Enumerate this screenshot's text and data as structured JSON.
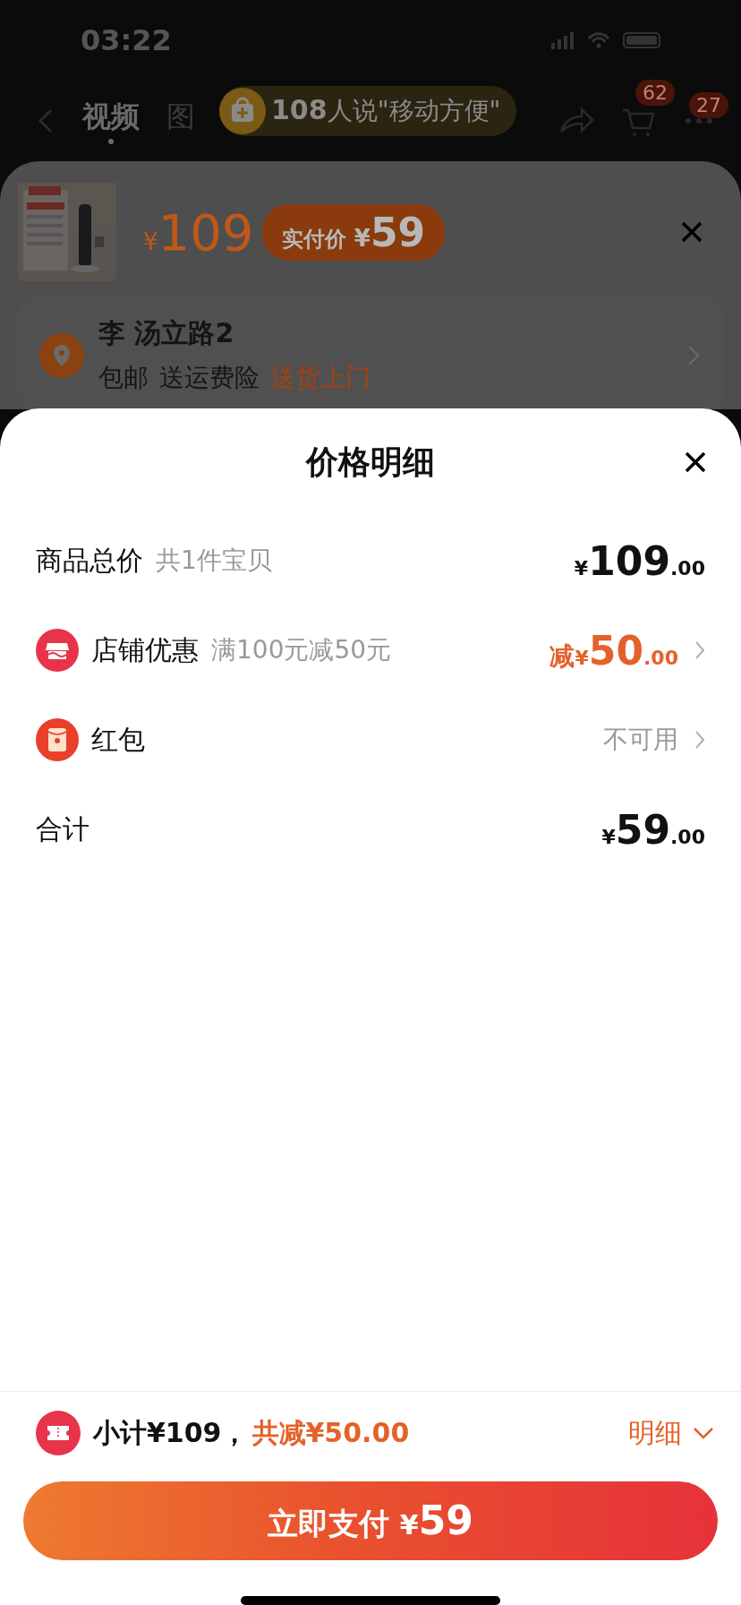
{
  "status_bar": {
    "time": "03:22"
  },
  "nav": {
    "tabs": [
      {
        "label": "视频",
        "selected": true
      },
      {
        "label": "图",
        "selected": false
      }
    ],
    "banner": {
      "count": "108",
      "text": "人说\"移动方便\""
    },
    "cart_badge": "62",
    "more_badge": "27"
  },
  "order_sheet": {
    "price": {
      "currency": "¥",
      "amount": "109"
    },
    "pay_price": {
      "label": "实付价",
      "currency": "¥",
      "amount": "59"
    },
    "address": {
      "name": "李 汤立路2",
      "tags": [
        {
          "text": "包邮",
          "highlight": false
        },
        {
          "text": "送运费险",
          "highlight": false
        },
        {
          "text": "送货上门",
          "highlight": true
        }
      ]
    }
  },
  "price_detail": {
    "title": "价格明细",
    "rows": [
      {
        "kind": "plain",
        "label": "商品总价",
        "note": "共1件宝贝",
        "price": {
          "currency": "¥",
          "integer": "109",
          "decimals": ".00"
        }
      },
      {
        "kind": "shop_discount",
        "label": "店铺优惠",
        "note": "满100元减50元",
        "price": {
          "prefix": "减",
          "currency": "¥",
          "integer": "50",
          "decimals": ".00"
        }
      },
      {
        "kind": "red_packet",
        "label": "红包",
        "status": "不可用"
      },
      {
        "kind": "plain",
        "label": "合计",
        "price": {
          "currency": "¥",
          "integer": "59",
          "decimals": ".00"
        }
      }
    ]
  },
  "footer": {
    "subtotal": "小计¥109，",
    "discount_total": "共减¥50.00",
    "detail_link": "明细",
    "pay_button": {
      "label": "立即支付",
      "currency": "¥",
      "amount": "59"
    }
  }
}
